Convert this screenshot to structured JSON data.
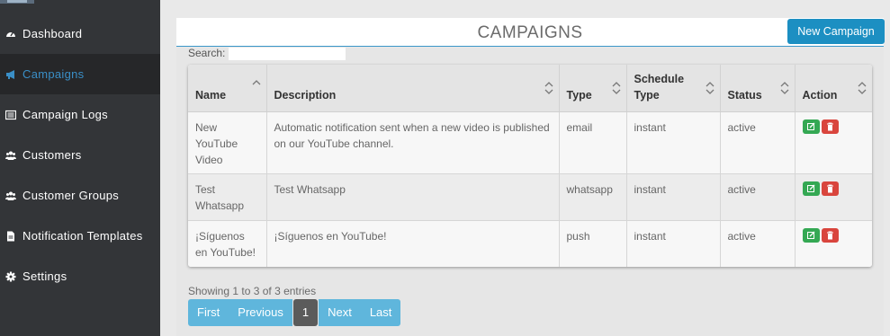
{
  "sidebar": {
    "items": [
      {
        "label": "Dashboard",
        "icon": "dashboard-icon",
        "active": false
      },
      {
        "label": "Campaigns",
        "icon": "bullhorn-icon",
        "active": true
      },
      {
        "label": "Campaign Logs",
        "icon": "list-icon",
        "active": false
      },
      {
        "label": "Customers",
        "icon": "users-icon",
        "active": false
      },
      {
        "label": "Customer Groups",
        "icon": "users-icon",
        "active": false
      },
      {
        "label": "Notification Templates",
        "icon": "file-icon",
        "active": false
      },
      {
        "label": "Settings",
        "icon": "gear-icon",
        "active": false
      }
    ]
  },
  "panel": {
    "title": "CAMPAIGNS",
    "new_button": "New Campaign",
    "search_label": "Search:",
    "search_value": ""
  },
  "table": {
    "columns": [
      "Name",
      "Description",
      "Type",
      "Schedule Type",
      "Status",
      "Action"
    ],
    "rows": [
      {
        "name": "New YouTube Video",
        "description": "Automatic notification sent when a new video is published on our YouTube channel.",
        "type": "email",
        "schedule_type": "instant",
        "status": "active"
      },
      {
        "name": "Test Whatsapp",
        "description": "Test Whatsapp",
        "type": "whatsapp",
        "schedule_type": "instant",
        "status": "active"
      },
      {
        "name": "¡Síguenos en YouTube!",
        "description": "¡Síguenos en YouTube!",
        "type": "push",
        "schedule_type": "instant",
        "status": "active"
      }
    ]
  },
  "footer": {
    "showing": "Showing 1 to 3 of 3 entries",
    "pager": {
      "first": "First",
      "previous": "Previous",
      "current": "1",
      "next": "Next",
      "last": "Last"
    }
  },
  "colors": {
    "sidebar_bg": "#333538",
    "active_bg": "#262729",
    "accent": "#1c8fc2",
    "edit": "#34a853",
    "delete": "#d9453d",
    "pager": "#5fb6dc"
  }
}
